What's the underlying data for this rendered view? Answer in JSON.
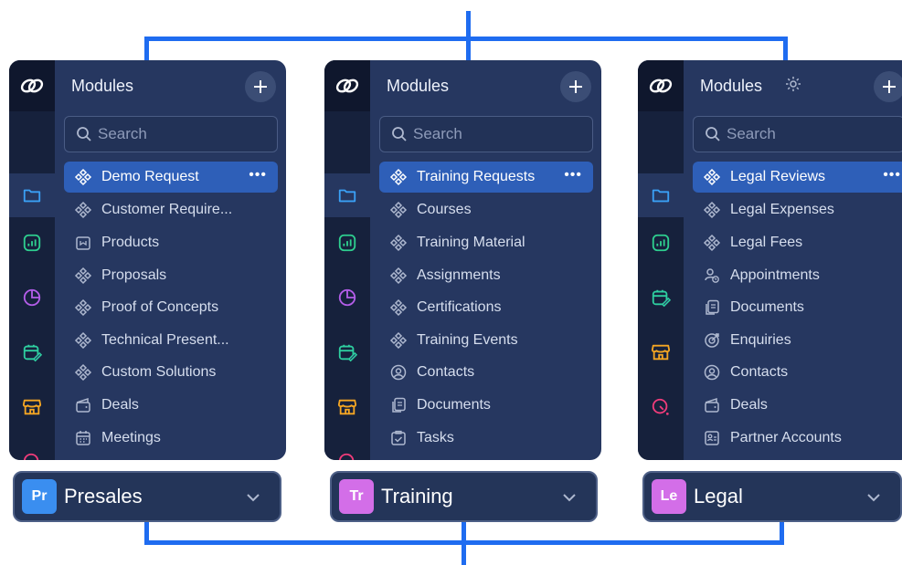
{
  "colors": {
    "connector": "#1f6cf0",
    "panel": "#263760",
    "rail": "#16213c",
    "selected": "#2e5fb8",
    "presales_badge": "#3a8ef0",
    "training_badge": "#d36ee8",
    "legal_badge": "#d36ee8"
  },
  "panels": [
    {
      "title": "Modules",
      "search_placeholder": "Search",
      "items": [
        {
          "label": "Demo Request",
          "icon": "module-icon",
          "selected": true
        },
        {
          "label": "Customer Require...",
          "icon": "module-icon"
        },
        {
          "label": "Products",
          "icon": "product-icon"
        },
        {
          "label": "Proposals",
          "icon": "module-icon"
        },
        {
          "label": "Proof of Concepts",
          "icon": "module-icon"
        },
        {
          "label": "Technical Present...",
          "icon": "module-icon"
        },
        {
          "label": "Custom Solutions",
          "icon": "module-icon"
        },
        {
          "label": "Deals",
          "icon": "wallet-icon"
        },
        {
          "label": "Meetings",
          "icon": "calendar-icon"
        }
      ],
      "more": "•••",
      "workspace": {
        "badge": "Pr",
        "name": "Presales"
      }
    },
    {
      "title": "Modules",
      "search_placeholder": "Search",
      "items": [
        {
          "label": "Training Requests",
          "icon": "module-icon",
          "selected": true
        },
        {
          "label": "Courses",
          "icon": "module-icon"
        },
        {
          "label": "Training Material",
          "icon": "module-icon"
        },
        {
          "label": "Assignments",
          "icon": "module-icon"
        },
        {
          "label": "Certifications",
          "icon": "module-icon"
        },
        {
          "label": "Training Events",
          "icon": "module-icon"
        },
        {
          "label": "Contacts",
          "icon": "contact-icon"
        },
        {
          "label": "Documents",
          "icon": "document-icon"
        },
        {
          "label": "Tasks",
          "icon": "task-icon"
        }
      ],
      "more": "•••",
      "workspace": {
        "badge": "Tr",
        "name": "Training"
      }
    },
    {
      "title": "Modules",
      "search_placeholder": "Search",
      "items": [
        {
          "label": "Legal Reviews",
          "icon": "module-icon",
          "selected": true
        },
        {
          "label": "Legal Expenses",
          "icon": "module-icon"
        },
        {
          "label": "Legal Fees",
          "icon": "module-icon"
        },
        {
          "label": "Appointments",
          "icon": "appointment-icon"
        },
        {
          "label": "Documents",
          "icon": "document-icon"
        },
        {
          "label": "Enquiries",
          "icon": "enquiry-icon"
        },
        {
          "label": "Contacts",
          "icon": "contact-icon"
        },
        {
          "label": "Deals",
          "icon": "wallet-icon"
        },
        {
          "label": "Partner Accounts",
          "icon": "partner-icon"
        }
      ],
      "more": "•••",
      "workspace": {
        "badge": "Le",
        "name": "Legal"
      }
    }
  ]
}
